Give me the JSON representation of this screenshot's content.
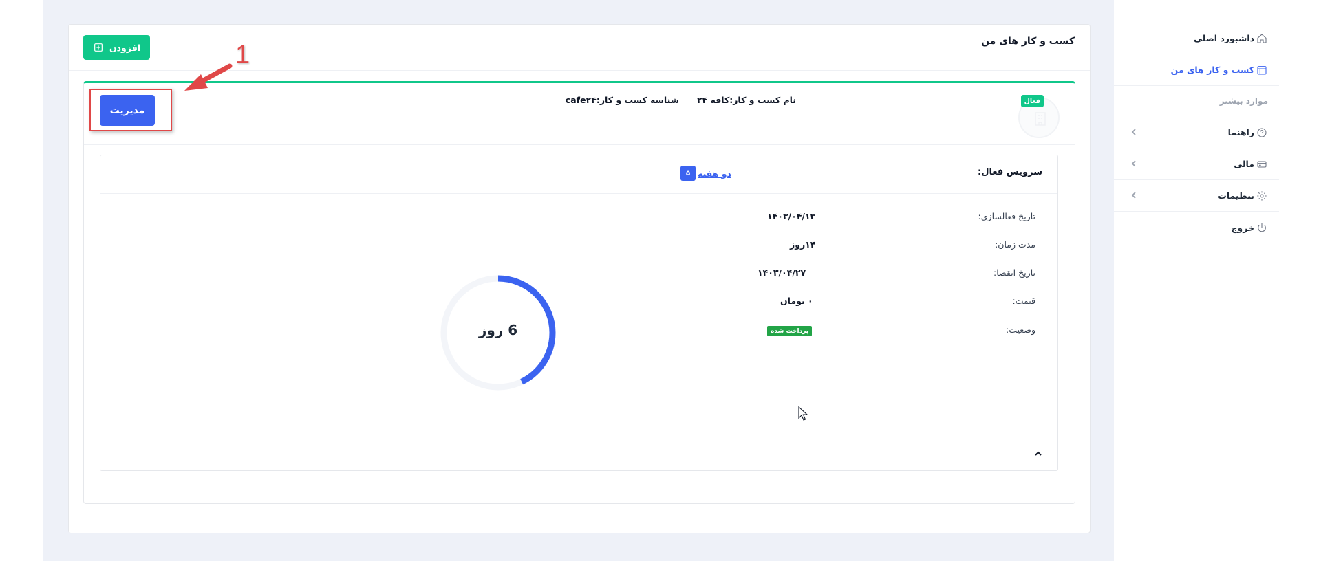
{
  "sidebar": {
    "items": [
      {
        "label": "داشبورد اصلی",
        "icon": "home-icon",
        "active": false
      },
      {
        "label": "کسب و کار های من",
        "icon": "calendar-icon",
        "active": true
      }
    ],
    "more_heading": "موارد بیشتر",
    "more_items": [
      {
        "label": "راهنما",
        "icon": "help-icon"
      },
      {
        "label": "مالی",
        "icon": "card-icon"
      },
      {
        "label": "تنظیمات",
        "icon": "gear-icon"
      },
      {
        "label": "خروج",
        "icon": "power-icon"
      }
    ]
  },
  "page": {
    "title": "کسب و کار های من",
    "add_button": "افزودن"
  },
  "business": {
    "status_badge": "فعال",
    "name_label": "نام کسب و کار:",
    "name_value": "کافه ۲۴",
    "id_label": "شناسه کسب و کار:",
    "id_value": "cafe۲۴",
    "manage_button": "مدیریت"
  },
  "annotation": {
    "step_number": "1"
  },
  "service": {
    "title": "سرویس فعال:",
    "plan_name": "دو هفته",
    "plan_badge": "۵",
    "rows": {
      "activation_label": "تاریخ فعالسازی:",
      "activation_value": "۱۴۰۳/۰۴/۱۳",
      "duration_label": "مدت زمان:",
      "duration_value": "۱۴روز",
      "expiry_label": "تاریخ انقضا:",
      "expiry_value": "۱۴۰۳/۰۴/۲۷",
      "price_label": "قیمت:",
      "price_value": "۰ تومان",
      "status_label": "وضعیت:",
      "status_value": "پرداخت شده"
    },
    "remaining": {
      "label": "6 روز",
      "days_remaining": 6,
      "total_days": 14
    }
  },
  "colors": {
    "primary": "#3b63f0",
    "success": "#10c78a",
    "paid": "#22a447",
    "annotation": "#e04848"
  }
}
